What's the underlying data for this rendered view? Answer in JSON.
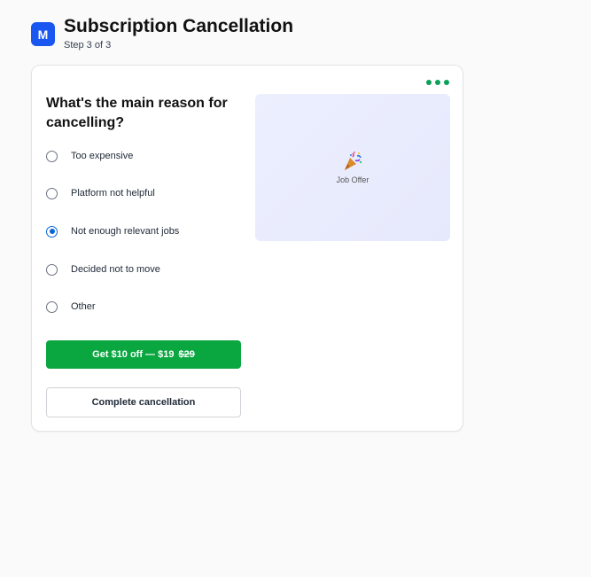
{
  "header": {
    "logo_letter": "M",
    "title": "Subscription Cancellation",
    "step": "Step 3 of 3"
  },
  "question": "What's the main reason for cancelling?",
  "options": [
    {
      "label": "Too expensive",
      "checked": false
    },
    {
      "label": "Platform not helpful",
      "checked": false
    },
    {
      "label": "Not enough relevant jobs",
      "checked": true
    },
    {
      "label": "Decided not to move",
      "checked": false
    },
    {
      "label": "Other",
      "checked": false
    }
  ],
  "offer_button": {
    "label": "Get $10 off — $19",
    "old_price": "$29"
  },
  "cancel_button": {
    "label": "Complete cancellation"
  },
  "offer_panel": {
    "icon": "party-popper-icon",
    "label": "Job Offer"
  },
  "colors": {
    "brand": "#1a56f0",
    "accent_green": "#0aa640",
    "radio_selected": "#0a66d6"
  }
}
